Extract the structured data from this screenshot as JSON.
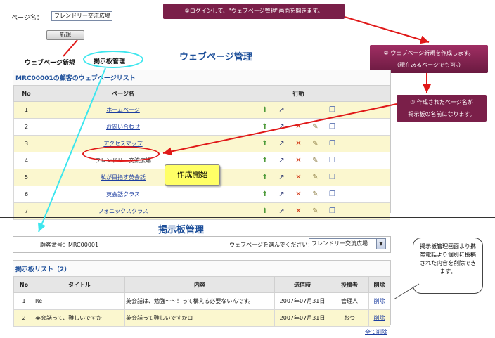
{
  "page_name": {
    "label": "ページ名：",
    "value": "フレンドリー交流広場",
    "new_button": "新規"
  },
  "nav": {
    "new_webpage": "ウェブページ新規",
    "board_manage": "掲示板管理"
  },
  "webpage_section": {
    "title": "ウェブページ管理",
    "caption": "MRC00001の顧客のウェブページリスト",
    "headers": {
      "no": "No",
      "name": "ページ名",
      "action": "行動"
    },
    "rows": [
      {
        "no": "1",
        "name": "ホームページ"
      },
      {
        "no": "2",
        "name": "お問い合わせ"
      },
      {
        "no": "3",
        "name": "アクセスマップ"
      },
      {
        "no": "4",
        "name": "フレンドリー交流広場"
      },
      {
        "no": "5",
        "name": "私が目指す英会話"
      },
      {
        "no": "6",
        "name": "英会話クラス"
      },
      {
        "no": "7",
        "name": "フォニックスクラス"
      }
    ]
  },
  "callouts": {
    "c1": "①ログインして、\"ウェブページ管理\"画面を開きます。",
    "c2_line1": "② ウェブページ新規を作成します。",
    "c2_line2": "（現在あるページでも可。）",
    "c3_line1": "③ 作成されたページ名が",
    "c3_line2": "掲示板の名前になります。",
    "c4": "作成開始",
    "c5": "掲示板管理画面より携帯電話より個別に投稿された内容を削除できます。"
  },
  "board_section": {
    "title": "掲示板管理",
    "customer_label": "顧客番号：MRC00001",
    "select_label": "ウェブページを選んでください：",
    "select_value": "フレンドリー交流広場",
    "caption": "掲示板リスト（2）",
    "headers": {
      "no": "No",
      "title": "タイトル",
      "content": "内容",
      "sent": "送信時",
      "poster": "投稿者",
      "delete": "削除"
    },
    "rows": [
      {
        "no": "1",
        "title": "Re",
        "content": "英会話は、勉強〜〜！って構える必要ないんです。",
        "sent": "2007年07月31日",
        "poster": "管理人",
        "delete": "削除"
      },
      {
        "no": "2",
        "title": "英会話って、難しいですか",
        "content": "英会話って難しいですかロ",
        "sent": "2007年07月31日",
        "poster": "おつ",
        "delete": "削除"
      }
    ],
    "delete_all": "全て削除"
  },
  "icons": [
    "upload-icon",
    "link-icon",
    "delete-icon",
    "edit-icon",
    "copy-icon"
  ]
}
